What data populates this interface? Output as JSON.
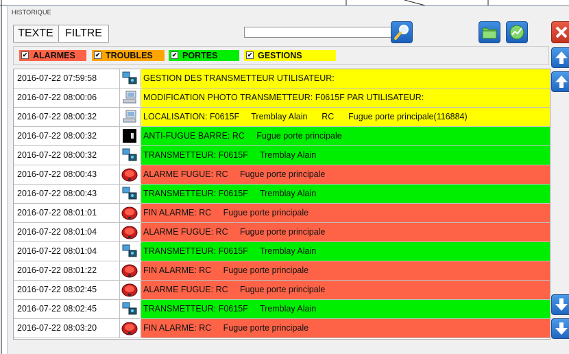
{
  "window": {
    "title": "HISTORIQUE"
  },
  "tabs": [
    {
      "label": "TEXTE"
    },
    {
      "label": "FILTRE"
    }
  ],
  "search": {
    "value": ""
  },
  "filters": [
    {
      "label": "ALARMES",
      "checked": "✔",
      "color": "#ff6347"
    },
    {
      "label": "TROUBLES",
      "checked": "✔",
      "color": "#ffa500"
    },
    {
      "label": "PORTES",
      "checked": "✔",
      "color": "#00ee00"
    },
    {
      "label": "GESTIONS",
      "checked": "✔",
      "color": "#ffff00"
    }
  ],
  "colors": {
    "yellow": "#ffff00",
    "green": "#00ee00",
    "red": "#ff6347"
  },
  "rows": [
    {
      "date": "2016-07-22 07:59:58",
      "icon": "transmitter-icon",
      "type": "yellow",
      "message": "GESTION DES TRANSMETTEUR UTILISATEUR:"
    },
    {
      "date": "2016-07-22 08:00:06",
      "icon": "computer-icon",
      "type": "yellow",
      "message": "MODIFICATION PHOTO TRANSMETTEUR: F0615F PAR UTILISATEUR:"
    },
    {
      "date": "2016-07-22 08:00:32",
      "icon": "computer-icon",
      "type": "yellow",
      "message": "LOCALISATION: F0615F     Tremblay Alain      RC      Fugue porte principale(116884)"
    },
    {
      "date": "2016-07-22 08:00:32",
      "icon": "door-bar-icon",
      "type": "green",
      "message": "ANTI-FUGUE BARRE: RC     Fugue porte principale"
    },
    {
      "date": "2016-07-22 08:00:32",
      "icon": "transmitter-icon",
      "type": "green",
      "message": "TRANSMETTEUR: F0615F     Tremblay Alain"
    },
    {
      "date": "2016-07-22 08:00:43",
      "icon": "alarm-bell-icon",
      "type": "red",
      "message": "ALARME FUGUE: RC     Fugue porte principale"
    },
    {
      "date": "2016-07-22 08:00:43",
      "icon": "transmitter-icon",
      "type": "green",
      "message": "TRANSMETTEUR: F0615F     Tremblay Alain"
    },
    {
      "date": "2016-07-22 08:01:01",
      "icon": "alarm-bell-icon",
      "type": "red",
      "message": "FIN ALARME: RC     Fugue porte principale"
    },
    {
      "date": "2016-07-22 08:01:04",
      "icon": "alarm-bell-icon",
      "type": "red",
      "message": "ALARME FUGUE: RC     Fugue porte principale"
    },
    {
      "date": "2016-07-22 08:01:04",
      "icon": "transmitter-icon",
      "type": "green",
      "message": "TRANSMETTEUR: F0615F     Tremblay Alain"
    },
    {
      "date": "2016-07-22 08:01:22",
      "icon": "alarm-bell-icon",
      "type": "red",
      "message": "FIN ALARME: RC     Fugue porte principale"
    },
    {
      "date": "2016-07-22 08:02:45",
      "icon": "alarm-bell-icon",
      "type": "red",
      "message": "ALARME FUGUE: RC     Fugue porte principale"
    },
    {
      "date": "2016-07-22 08:02:45",
      "icon": "transmitter-icon",
      "type": "green",
      "message": "TRANSMETTEUR: F0615F     Tremblay Alain"
    },
    {
      "date": "2016-07-22 08:03:20",
      "icon": "alarm-bell-icon",
      "type": "red",
      "message": "FIN ALARME: RC     Fugue porte principale"
    }
  ]
}
